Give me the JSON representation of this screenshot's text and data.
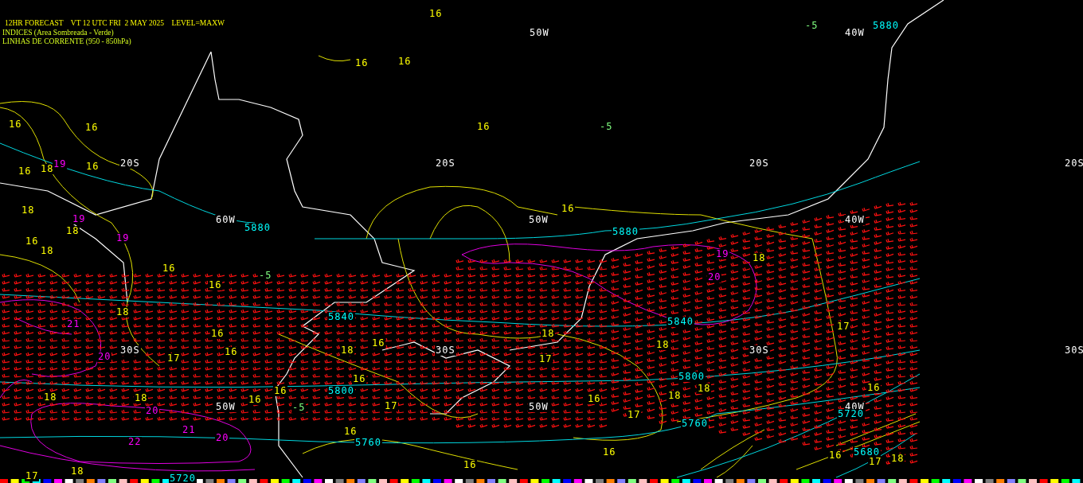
{
  "header": {
    "lines": [
      "12HR FORECAST    VT 12 UTC FRI  2 MAY 2025    LEVEL=MAXW",
      "INDICES (Area Sombreada - Verde)",
      "LINHAS DE CORRENTE (950 - 850hPa)"
    ]
  },
  "map": {
    "labels": [
      {
        "text": "16",
        "color": "#ffff00"
      },
      {
        "text": "50W",
        "color": "#ffffff"
      },
      {
        "text": "-5",
        "color": "#80ff80"
      },
      {
        "text": "40W",
        "color": "#ffffff"
      },
      {
        "text": "5880",
        "color": "#00ffff"
      },
      {
        "text": "16",
        "color": "#ffff00"
      },
      {
        "text": "16",
        "color": "#ffff00"
      },
      {
        "text": "16",
        "color": "#ffff00"
      },
      {
        "text": "16",
        "color": "#ffff00"
      },
      {
        "text": "16",
        "color": "#ffff00"
      },
      {
        "text": "-5",
        "color": "#80ff80"
      },
      {
        "text": "20S",
        "color": "#ffffff"
      },
      {
        "text": "20S",
        "color": "#ffffff"
      },
      {
        "text": "20S",
        "color": "#ffffff"
      },
      {
        "text": "20S",
        "color": "#ffffff"
      },
      {
        "text": "16",
        "color": "#ffff00"
      },
      {
        "text": "18",
        "color": "#ffff00"
      },
      {
        "text": "19",
        "color": "#ff00ff"
      },
      {
        "text": "16",
        "color": "#ffff00"
      },
      {
        "text": "18",
        "color": "#ffff00"
      },
      {
        "text": "19",
        "color": "#ff00ff"
      },
      {
        "text": "18",
        "color": "#ffff00"
      },
      {
        "text": "19",
        "color": "#ff00ff"
      },
      {
        "text": "60W",
        "color": "#ffffff"
      },
      {
        "text": "5880",
        "color": "#00ffff"
      },
      {
        "text": "50W",
        "color": "#ffffff"
      },
      {
        "text": "16",
        "color": "#ffff00"
      },
      {
        "text": "5880",
        "color": "#00ffff"
      },
      {
        "text": "40W",
        "color": "#ffffff"
      },
      {
        "text": "16",
        "color": "#ffff00"
      },
      {
        "text": "18",
        "color": "#ffff00"
      },
      {
        "text": "16",
        "color": "#ffff00"
      },
      {
        "text": "16",
        "color": "#ffff00"
      },
      {
        "text": "-5",
        "color": "#80ff80"
      },
      {
        "text": "19",
        "color": "#ff00ff"
      },
      {
        "text": "18",
        "color": "#ffff00"
      },
      {
        "text": "20",
        "color": "#ff00ff"
      },
      {
        "text": "18",
        "color": "#ffff00"
      },
      {
        "text": "5840",
        "color": "#00ffff"
      },
      {
        "text": "5840",
        "color": "#00ffff"
      },
      {
        "text": "17",
        "color": "#ffff00"
      },
      {
        "text": "21",
        "color": "#ff00ff"
      },
      {
        "text": "16",
        "color": "#ffff00"
      },
      {
        "text": "18",
        "color": "#ffff00"
      },
      {
        "text": "16",
        "color": "#ffff00"
      },
      {
        "text": "30S",
        "color": "#ffffff"
      },
      {
        "text": "30S",
        "color": "#ffffff"
      },
      {
        "text": "30S",
        "color": "#ffffff"
      },
      {
        "text": "30S",
        "color": "#ffffff"
      },
      {
        "text": "20",
        "color": "#ff00ff"
      },
      {
        "text": "17",
        "color": "#ffff00"
      },
      {
        "text": "16",
        "color": "#ffff00"
      },
      {
        "text": "18",
        "color": "#ffff00"
      },
      {
        "text": "17",
        "color": "#ffff00"
      },
      {
        "text": "18",
        "color": "#ffff00"
      },
      {
        "text": "16",
        "color": "#ffff00"
      },
      {
        "text": "5800",
        "color": "#00ffff"
      },
      {
        "text": "5800",
        "color": "#00ffff"
      },
      {
        "text": "16",
        "color": "#ffff00"
      },
      {
        "text": "18",
        "color": "#ffff00"
      },
      {
        "text": "18",
        "color": "#ffff00"
      },
      {
        "text": "50W",
        "color": "#ffffff"
      },
      {
        "text": "16",
        "color": "#ffff00"
      },
      {
        "text": "16",
        "color": "#ffff00"
      },
      {
        "text": "-5",
        "color": "#80ff80"
      },
      {
        "text": "17",
        "color": "#ffff00"
      },
      {
        "text": "16",
        "color": "#ffff00"
      },
      {
        "text": "18",
        "color": "#ffff00"
      },
      {
        "text": "18",
        "color": "#ffff00"
      },
      {
        "text": "50W",
        "color": "#ffffff"
      },
      {
        "text": "40W",
        "color": "#ffffff"
      },
      {
        "text": "5720",
        "color": "#00ffff"
      },
      {
        "text": "20",
        "color": "#ff00ff"
      },
      {
        "text": "17",
        "color": "#ffff00"
      },
      {
        "text": "5760",
        "color": "#00ffff"
      },
      {
        "text": "21",
        "color": "#ff00ff"
      },
      {
        "text": "20",
        "color": "#ff00ff"
      },
      {
        "text": "22",
        "color": "#ff00ff"
      },
      {
        "text": "16",
        "color": "#ffff00"
      },
      {
        "text": "5760",
        "color": "#00ffff"
      },
      {
        "text": "16",
        "color": "#ffff00"
      },
      {
        "text": "16",
        "color": "#ffff00"
      },
      {
        "text": "16",
        "color": "#ffff00"
      },
      {
        "text": "5680",
        "color": "#00ffff"
      },
      {
        "text": "17",
        "color": "#ffff00"
      },
      {
        "text": "18",
        "color": "#ffff00"
      },
      {
        "text": "18",
        "color": "#ffff00"
      },
      {
        "text": "17",
        "color": "#ffff00"
      },
      {
        "text": "5720",
        "color": "#00ffff"
      }
    ]
  }
}
